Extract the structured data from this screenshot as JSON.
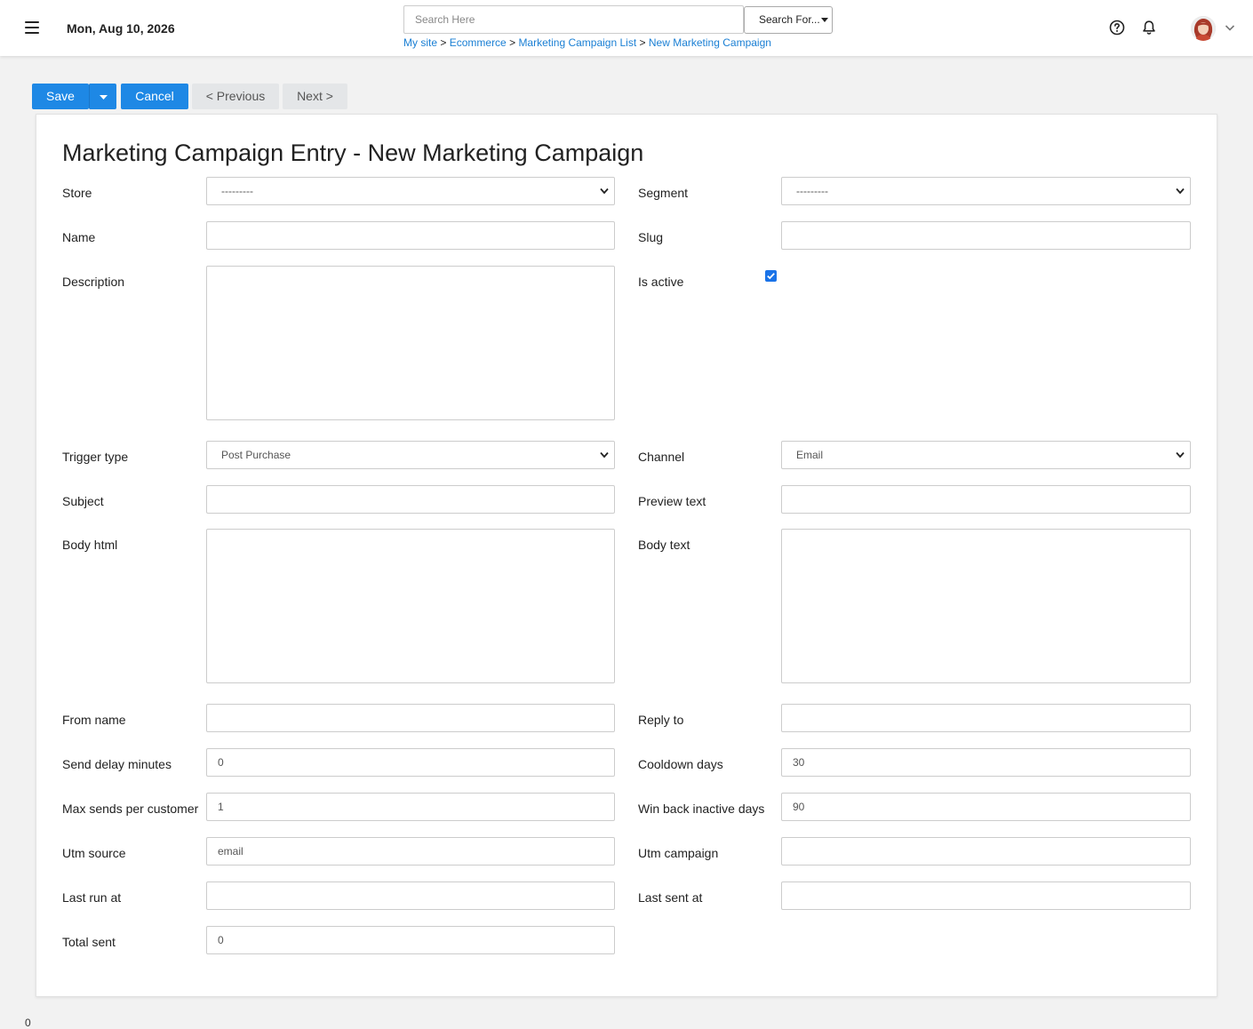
{
  "header": {
    "date": "Mon, Aug 10, 2026",
    "search_placeholder": "Search Here",
    "search_for_label": "Search For...",
    "breadcrumb": [
      "My site",
      "Ecommerce",
      "Marketing Campaign List",
      "New Marketing Campaign"
    ],
    "breadcrumb_sep": ">"
  },
  "toolbar": {
    "save_label": "Save",
    "cancel_label": "Cancel",
    "previous_label": "< Previous",
    "next_label": "Next >"
  },
  "form": {
    "title": "Marketing Campaign Entry - New Marketing Campaign",
    "store": {
      "label": "Store",
      "value": "---------"
    },
    "segment": {
      "label": "Segment",
      "value": "---------"
    },
    "name": {
      "label": "Name",
      "value": ""
    },
    "slug": {
      "label": "Slug",
      "value": ""
    },
    "description": {
      "label": "Description",
      "value": ""
    },
    "is_active": {
      "label": "Is active",
      "checked": true
    },
    "trigger_type": {
      "label": "Trigger type",
      "value": "Post Purchase"
    },
    "channel": {
      "label": "Channel",
      "value": "Email"
    },
    "subject": {
      "label": "Subject",
      "value": ""
    },
    "preview_text": {
      "label": "Preview text",
      "value": ""
    },
    "body_html": {
      "label": "Body html",
      "value": ""
    },
    "body_text": {
      "label": "Body text",
      "value": ""
    },
    "from_name": {
      "label": "From name",
      "value": ""
    },
    "reply_to": {
      "label": "Reply to",
      "value": ""
    },
    "send_delay_minutes": {
      "label": "Send delay minutes",
      "value": "0"
    },
    "cooldown_days": {
      "label": "Cooldown days",
      "value": "30"
    },
    "max_sends_per_customer": {
      "label": "Max sends per customer",
      "value": "1"
    },
    "win_back_inactive_days": {
      "label": "Win back inactive days",
      "value": "90"
    },
    "utm_source": {
      "label": "Utm source",
      "value": "email"
    },
    "utm_campaign": {
      "label": "Utm campaign",
      "value": ""
    },
    "last_run_at": {
      "label": "Last run at",
      "value": ""
    },
    "last_sent_at": {
      "label": "Last sent at",
      "value": ""
    },
    "total_sent": {
      "label": "Total sent",
      "value": "0"
    }
  },
  "footer": {
    "char": "0"
  },
  "colors": {
    "primary": "#1e88e5",
    "link": "#1a7fd4",
    "checkbox": "#1a73e8"
  }
}
